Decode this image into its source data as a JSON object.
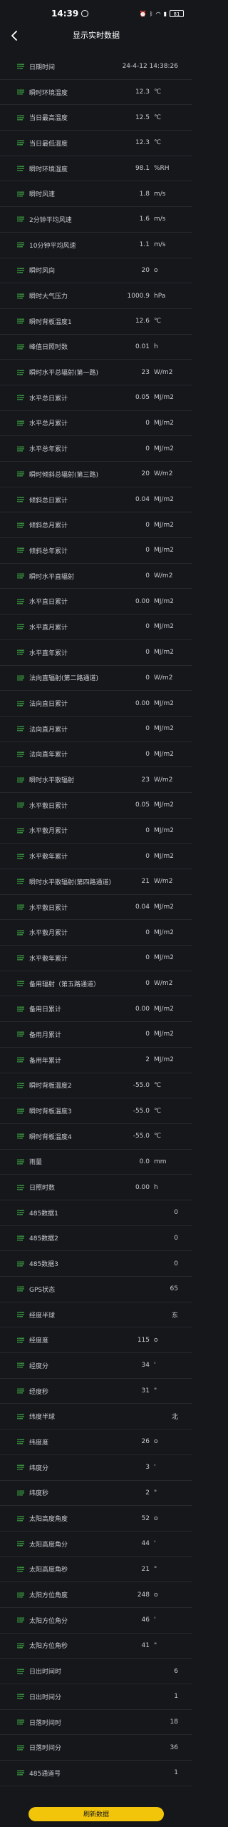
{
  "status_bar": {
    "time": "14:39",
    "battery": "81"
  },
  "header": {
    "title": "显示实时数据"
  },
  "rows": [
    {
      "label": "日期时间",
      "value": "24-4-12 14:38:26",
      "unit": ""
    },
    {
      "label": "瞬时环境温度",
      "value": "12.3",
      "unit": "℃"
    },
    {
      "label": "当日最高温度",
      "value": "12.5",
      "unit": "℃"
    },
    {
      "label": "当日最低温度",
      "value": "12.3",
      "unit": "℃"
    },
    {
      "label": "瞬时环境湿度",
      "value": "98.1",
      "unit": "%RH"
    },
    {
      "label": "瞬时风速",
      "value": "1.8",
      "unit": "m/s"
    },
    {
      "label": "2分钟平均风速",
      "value": "1.6",
      "unit": "m/s"
    },
    {
      "label": "10分钟平均风速",
      "value": "1.1",
      "unit": "m/s"
    },
    {
      "label": "瞬时风向",
      "value": "20",
      "unit": "o"
    },
    {
      "label": "瞬时大气压力",
      "value": "1000.9",
      "unit": "hPa"
    },
    {
      "label": "瞬时背板温度1",
      "value": "12.6",
      "unit": "℃"
    },
    {
      "label": "峰值日照时数",
      "value": "0.01",
      "unit": "h"
    },
    {
      "label": "瞬时水平总辐射(第一路)",
      "value": "23",
      "unit": "W/m2"
    },
    {
      "label": "水平总日累计",
      "value": "0.05",
      "unit": "MJ/m2"
    },
    {
      "label": "水平总月累计",
      "value": "0",
      "unit": "MJ/m2"
    },
    {
      "label": "水平总年累计",
      "value": "0",
      "unit": "MJ/m2"
    },
    {
      "label": "瞬时倾斜总辐射(第三路)",
      "value": "20",
      "unit": "W/m2"
    },
    {
      "label": "倾斜总日累计",
      "value": "0.04",
      "unit": "MJ/m2"
    },
    {
      "label": "倾斜总月累计",
      "value": "0",
      "unit": "MJ/m2"
    },
    {
      "label": "倾斜总年累计",
      "value": "0",
      "unit": "MJ/m2"
    },
    {
      "label": "瞬时水平直辐射",
      "value": "0",
      "unit": "W/m2"
    },
    {
      "label": "水平直日累计",
      "value": "0.00",
      "unit": "MJ/m2"
    },
    {
      "label": "水平直月累计",
      "value": "0",
      "unit": "MJ/m2"
    },
    {
      "label": "水平直年累计",
      "value": "0",
      "unit": "MJ/m2"
    },
    {
      "label": "法向直辐射(第二路通道)",
      "value": "0",
      "unit": "W/m2"
    },
    {
      "label": "法向直日累计",
      "value": "0.00",
      "unit": "MJ/m2"
    },
    {
      "label": "法向直月累计",
      "value": "0",
      "unit": "MJ/m2"
    },
    {
      "label": "法向直年累计",
      "value": "0",
      "unit": "MJ/m2"
    },
    {
      "label": "瞬时水平散辐射",
      "value": "23",
      "unit": "W/m2"
    },
    {
      "label": "水平散日累计",
      "value": "0.05",
      "unit": "MJ/m2"
    },
    {
      "label": "水平散月累计",
      "value": "0",
      "unit": "MJ/m2"
    },
    {
      "label": "水平散年累计",
      "value": "0",
      "unit": "MJ/m2"
    },
    {
      "label": "瞬时水平散辐射(第四路通道)",
      "value": "21",
      "unit": "W/m2"
    },
    {
      "label": "水平散日累计",
      "value": "0.04",
      "unit": "MJ/m2"
    },
    {
      "label": "水平散月累计",
      "value": "0",
      "unit": "MJ/m2"
    },
    {
      "label": "水平散年累计",
      "value": "0",
      "unit": "MJ/m2"
    },
    {
      "label": "备用辐射（第五路通道）",
      "value": "0",
      "unit": "W/m2"
    },
    {
      "label": "备用日累计",
      "value": "0.00",
      "unit": "MJ/m2"
    },
    {
      "label": "备用月累计",
      "value": "0",
      "unit": "MJ/m2"
    },
    {
      "label": "备用年累计",
      "value": "2",
      "unit": "MJ/m2"
    },
    {
      "label": "瞬时背板温度2",
      "value": "-55.0",
      "unit": "℃"
    },
    {
      "label": "瞬时背板温度3",
      "value": "-55.0",
      "unit": "℃"
    },
    {
      "label": "瞬时背板温度4",
      "value": "-55.0",
      "unit": "℃"
    },
    {
      "label": "雨量",
      "value": "0.0",
      "unit": "mm"
    },
    {
      "label": "日照时数",
      "value": "0.00",
      "unit": "h"
    },
    {
      "label": "485数据1",
      "value": "0",
      "unit": ""
    },
    {
      "label": "485数据2",
      "value": "0",
      "unit": ""
    },
    {
      "label": "485数据3",
      "value": "0",
      "unit": ""
    },
    {
      "label": "GPS状态",
      "value": "65",
      "unit": ""
    },
    {
      "label": "经度半球",
      "value": "东",
      "unit": ""
    },
    {
      "label": "经度度",
      "value": "115",
      "unit": "o"
    },
    {
      "label": "经度分",
      "value": "34",
      "unit": "'"
    },
    {
      "label": "经度秒",
      "value": "31",
      "unit": "\""
    },
    {
      "label": "纬度半球",
      "value": "北",
      "unit": ""
    },
    {
      "label": "纬度度",
      "value": "26",
      "unit": "o"
    },
    {
      "label": "纬度分",
      "value": "3",
      "unit": "'"
    },
    {
      "label": "纬度秒",
      "value": "2",
      "unit": "\""
    },
    {
      "label": "太阳高度角度",
      "value": "52",
      "unit": "o"
    },
    {
      "label": "太阳高度角分",
      "value": "44",
      "unit": "'"
    },
    {
      "label": "太阳高度角秒",
      "value": "21",
      "unit": "\""
    },
    {
      "label": "太阳方位角度",
      "value": "248",
      "unit": "o"
    },
    {
      "label": "太阳方位角分",
      "value": "46",
      "unit": "'"
    },
    {
      "label": "太阳方位角秒",
      "value": "41",
      "unit": "\""
    },
    {
      "label": "日出时间时",
      "value": "6",
      "unit": ""
    },
    {
      "label": "日出时间分",
      "value": "1",
      "unit": ""
    },
    {
      "label": "日落时间时",
      "value": "18",
      "unit": ""
    },
    {
      "label": "日落时间分",
      "value": "36",
      "unit": ""
    },
    {
      "label": "485通道号",
      "value": "1",
      "unit": ""
    }
  ],
  "refresh_button": {
    "label": "刷新数据"
  },
  "colors": {
    "accent": "#f2c40a",
    "icon": "#3fae45",
    "background": "#15171b"
  }
}
